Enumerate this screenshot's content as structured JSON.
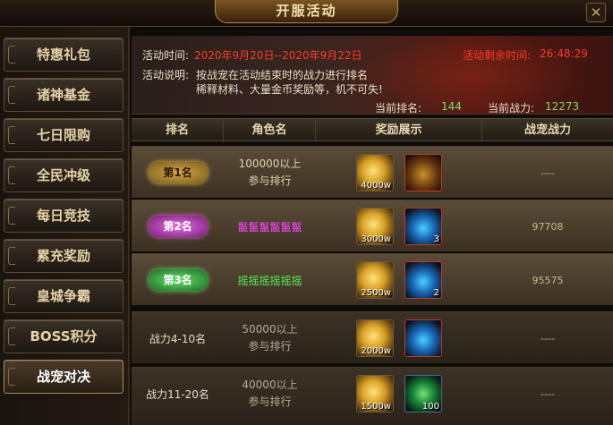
{
  "window": {
    "title": "开服活动",
    "close_symbol": "✕"
  },
  "sidebar": {
    "items": [
      {
        "label": "特惠礼包"
      },
      {
        "label": "诸神基金"
      },
      {
        "label": "七日限购"
      },
      {
        "label": "全民冲级"
      },
      {
        "label": "每日竞技"
      },
      {
        "label": "累充奖励"
      },
      {
        "label": "皇城争霸"
      },
      {
        "label": "BOSS积分"
      },
      {
        "label": "战宠对决"
      }
    ],
    "active_index": 8
  },
  "banner": {
    "time_label": "活动时间:",
    "time_value": "2020年9月20日--2020年9月22日",
    "remaining_label": "活动剩余时间:",
    "remaining_value": "26:48:29",
    "desc_label": "活动说明:",
    "desc_line1": "按战宠在活动结束时的战力进行排名",
    "desc_line2": "稀释材料、大量金币奖励等，机不可失!",
    "current_rank_label": "当前排名:",
    "current_rank_value": "144",
    "current_power_label": "当前战力:",
    "current_power_value": "12273"
  },
  "table": {
    "headers": [
      "排名",
      "角色名",
      "奖励展示",
      "战宠战力"
    ],
    "rows": [
      {
        "rank": "第1名",
        "req1": "100000以上",
        "req2": "参与排行",
        "name": "",
        "gold_qty": "4000w",
        "item_type": "chest",
        "item_qty": "",
        "power": "----"
      },
      {
        "rank": "第2名",
        "req1": "",
        "req2": "",
        "name": "鬣鬣鬣鬣鬣鬣",
        "gold_qty": "3000w",
        "item_type": "potion",
        "item_qty": "3",
        "power": "97708"
      },
      {
        "rank": "第3名",
        "req1": "",
        "req2": "",
        "name": "摇摇摇摇摇摇",
        "gold_qty": "2500w",
        "item_type": "potion",
        "item_qty": "2",
        "power": "95575"
      },
      {
        "rank": "战力4-10名",
        "req1": "50000以上",
        "req2": "参与排行",
        "name": "",
        "gold_qty": "2000w",
        "item_type": "potion",
        "item_qty": "",
        "power": "----"
      },
      {
        "rank": "战力11-20名",
        "req1": "40000以上",
        "req2": "参与排行",
        "name": "",
        "gold_qty": "1500w",
        "item_type": "orb",
        "item_qty": "100",
        "power": "----"
      }
    ]
  },
  "colors": {
    "accent_gold": "#f3e2a8",
    "time_red": "#ff3a2a",
    "value_green": "#7adf6a",
    "name_pink": "#ff44ff",
    "name_green": "#55ee55"
  }
}
